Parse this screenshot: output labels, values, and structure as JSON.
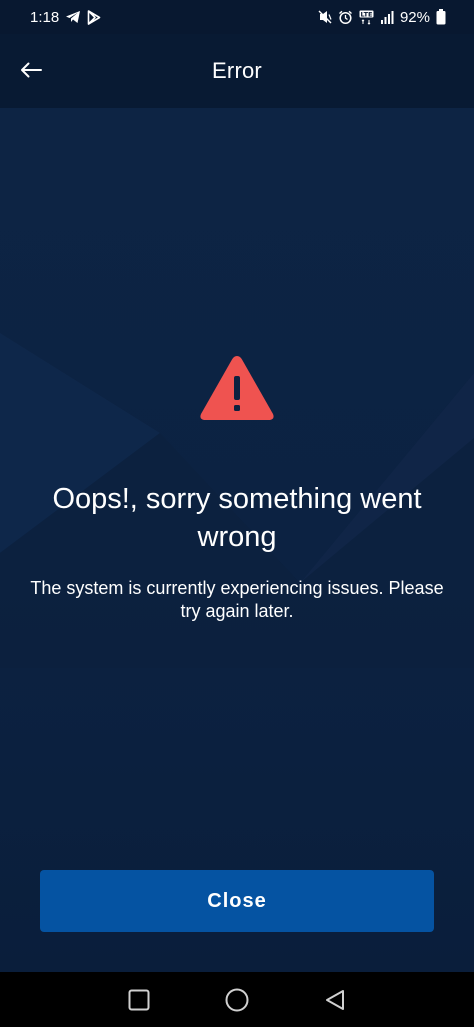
{
  "status_bar": {
    "time": "1:18",
    "battery": "92%",
    "left_icons": [
      "telegram-icon",
      "play-store-icon"
    ],
    "right_icons": [
      "mute-icon",
      "alarm-icon",
      "lte-icon",
      "signal-icon",
      "battery-icon"
    ]
  },
  "header": {
    "title": "Error",
    "back_icon": "arrow-left-icon"
  },
  "error": {
    "icon": "warning-icon",
    "icon_color": "#ef5350",
    "heading": "Oops!, sorry something went wrong",
    "message": "The system is currently experiencing issues. Please try again later."
  },
  "actions": {
    "close_label": "Close",
    "close_color": "#0553a2"
  },
  "nav": {
    "recents": "recents-icon",
    "home": "home-icon",
    "back": "back-icon"
  },
  "colors": {
    "background": "#0d2140",
    "header": "#081a33"
  }
}
